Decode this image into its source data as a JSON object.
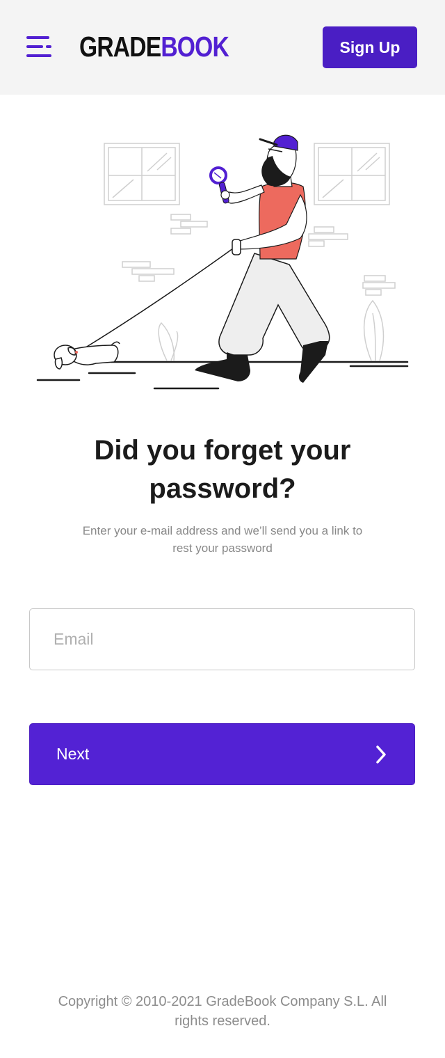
{
  "header": {
    "logo_part1": "GRADE",
    "logo_part2": "BOOK",
    "signup_label": "Sign Up",
    "menu_icon": "hamburger-menu-icon"
  },
  "main": {
    "title": "Did you forget your password?",
    "subtitle": "Enter your e-mail address and we’ll send you a link to rest your password",
    "email_placeholder": "Email",
    "email_value": "",
    "next_label": "Next",
    "next_icon": "chevron-right-icon"
  },
  "footer": {
    "copyright": "Copyright © 2010-2021 GradeBook Company S.L. All rights reserved."
  },
  "colors": {
    "brand": "#5220d2",
    "button": "#5322d4",
    "shirt": "#ed6a5e",
    "header_bg": "#f4f4f4"
  }
}
